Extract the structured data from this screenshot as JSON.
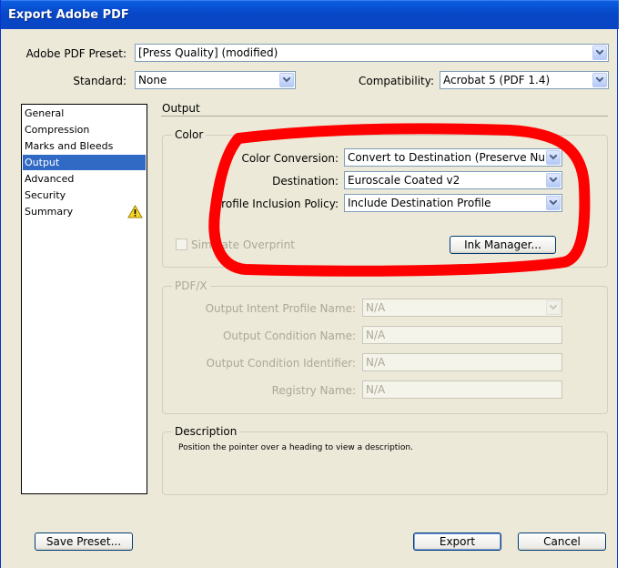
{
  "window": {
    "title": "Export Adobe PDF"
  },
  "preset": {
    "label": "Adobe PDF Preset:",
    "value": "[Press Quality] (modified)"
  },
  "standard": {
    "label": "Standard:",
    "value": "None"
  },
  "compatibility": {
    "label": "Compatibility:",
    "value": "Acrobat 5 (PDF 1.4)"
  },
  "sidebar": {
    "items": [
      {
        "label": "General"
      },
      {
        "label": "Compression"
      },
      {
        "label": "Marks and Bleeds"
      },
      {
        "label": "Output"
      },
      {
        "label": "Advanced"
      },
      {
        "label": "Security"
      },
      {
        "label": "Summary"
      }
    ],
    "selected": "Output",
    "warning_icon": "warning-icon"
  },
  "panel": {
    "title": "Output"
  },
  "color": {
    "group_title": "Color",
    "conversion_label": "Color Conversion:",
    "conversion_value": "Convert to Destination (Preserve Numb",
    "destination_label": "Destination:",
    "destination_value": "Euroscale Coated v2",
    "policy_label": "Profile Inclusion Policy:",
    "policy_value": "Include Destination Profile",
    "simulate_label": "Simulate Overprint",
    "ink_manager_label": "Ink Manager..."
  },
  "pdfx": {
    "group_title": "PDF/X",
    "intent_label": "Output Intent Profile Name:",
    "intent_value": "N/A",
    "condition_name_label": "Output Condition Name:",
    "condition_name_value": "N/A",
    "condition_id_label": "Output Condition Identifier:",
    "condition_id_value": "N/A",
    "registry_label": "Registry Name:",
    "registry_value": "N/A"
  },
  "description": {
    "group_title": "Description",
    "text": "Position the pointer over a heading to view a description."
  },
  "footer": {
    "save_preset_label": "Save Preset...",
    "export_label": "Export",
    "cancel_label": "Cancel"
  },
  "colors": {
    "titlebar": "#0A5FE0",
    "dialog_bg": "#ECE9D8",
    "selection": "#316AC5",
    "annotation": "#FF0000"
  }
}
